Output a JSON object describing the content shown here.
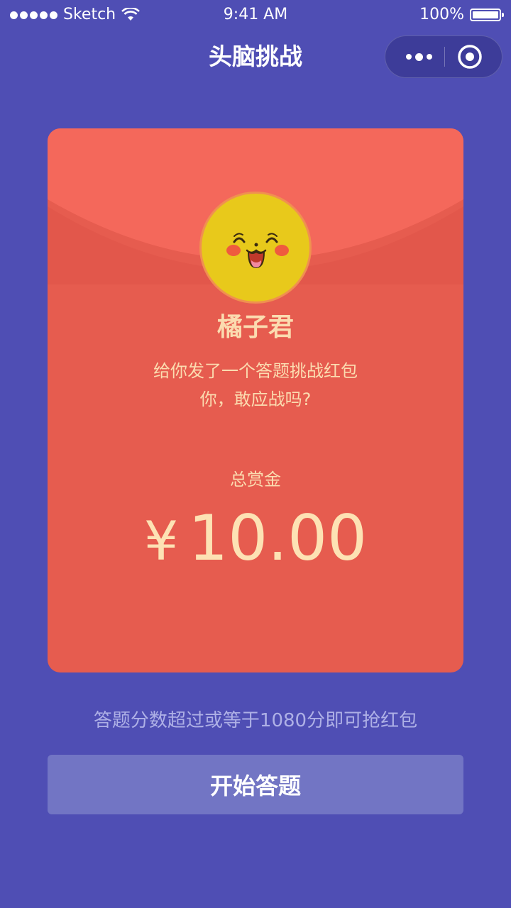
{
  "status_bar": {
    "carrier": "Sketch",
    "time": "9:41 AM",
    "battery": "100%"
  },
  "nav": {
    "title": "头脑挑战",
    "more_icon": "more-dots-icon",
    "close_icon": "target-close-icon"
  },
  "envelope": {
    "sender": "橘子君",
    "message_line1": "给你发了一个答题挑战红包",
    "message_line2": "你，敢应战吗?",
    "amount_label": "总赏金",
    "currency": "¥",
    "amount": "10.00"
  },
  "rule_text": "答题分数超过或等于1080分即可抢红包",
  "start_button": "开始答题",
  "colors": {
    "background": "#4f4eb4",
    "envelope_red": "#e65c4f",
    "flap_red": "#f4685b",
    "gold_text": "#fbdcb0",
    "button": "#7275c4"
  }
}
